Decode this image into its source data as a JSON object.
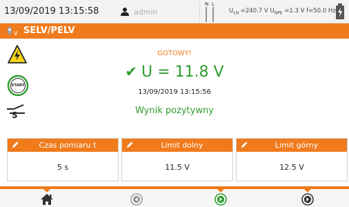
{
  "status_bar": {
    "datetime": "13/09/2019 13:15:58",
    "user": "admin",
    "conn_n": "N",
    "conn_l": "L",
    "readings": {
      "uln_label": "U",
      "uln_sub": "LN",
      "uln_value": "=240.7 V",
      "unpe_label": "U",
      "unpe_sub": "NPE",
      "unpe_value": "=1.3 V",
      "freq": "f=50.0 Hz"
    }
  },
  "title": "SELV/PELV",
  "result": {
    "status": "GOTOWY!",
    "value": "U = 11.8 V",
    "timestamp": "13/09/2019 13:15:56",
    "verdict": "Wynik pozytywny"
  },
  "start_label": "START",
  "probe_label": "S",
  "cards": [
    {
      "label": "Czas pomiaru t",
      "value": "5 s"
    },
    {
      "label": "Limit dolny",
      "value": "11.5 V"
    },
    {
      "label": "Limit górny",
      "value": "12.5 V"
    }
  ],
  "colors": {
    "accent": "#f07b1c",
    "pass": "#2e9e2e",
    "statusbar_bg": "#f3f3f3"
  },
  "nav": {
    "items": [
      "home-icon",
      "back-icon",
      "play-icon",
      "forward-icon"
    ]
  }
}
